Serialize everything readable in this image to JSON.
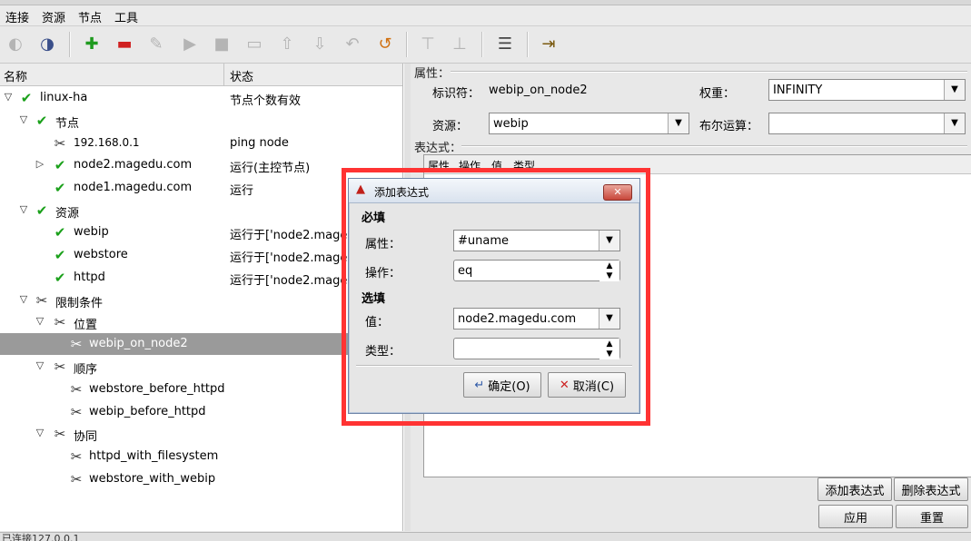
{
  "menubar": {
    "items": [
      "连接",
      "资源",
      "节点",
      "工具"
    ]
  },
  "toolbar": {
    "buttons": [
      {
        "icon": "connect-icon",
        "glyph": "◐"
      },
      {
        "icon": "disconnect-icon",
        "glyph": "◑"
      },
      {
        "icon": "add-icon",
        "glyph": "✚"
      },
      {
        "icon": "remove-icon",
        "glyph": "▬"
      },
      {
        "icon": "cleanup-icon",
        "glyph": "✎"
      },
      {
        "icon": "start-icon",
        "glyph": "▶"
      },
      {
        "icon": "stop-icon",
        "glyph": "■"
      },
      {
        "icon": "default-icon",
        "glyph": "▭"
      },
      {
        "icon": "up-icon",
        "glyph": "⇧"
      },
      {
        "icon": "down-icon",
        "glyph": "⇩"
      },
      {
        "icon": "undo-icon",
        "glyph": "↶"
      },
      {
        "icon": "refresh-icon",
        "glyph": "↺"
      },
      {
        "icon": "standby-icon",
        "glyph": "⊤"
      },
      {
        "icon": "active-icon",
        "glyph": "⊥"
      },
      {
        "icon": "log-icon",
        "glyph": "☰"
      },
      {
        "icon": "exit-icon",
        "glyph": "⇥"
      }
    ]
  },
  "tree": {
    "col_name": "名称",
    "col_status": "状态",
    "rows": [
      {
        "label": "linux-ha",
        "status": "节点个数有效",
        "icon": "check-icon",
        "glyph": "✔",
        "expander": "▽"
      },
      {
        "label": "节点",
        "status": "",
        "icon": "check-icon",
        "glyph": "✔",
        "expander": "▽"
      },
      {
        "label": "192.168.0.1",
        "status": "ping node",
        "icon": "tool-icon",
        "glyph": "✂",
        "expander": ""
      },
      {
        "label": "node2.magedu.com",
        "status": "运行(主控节点)",
        "icon": "check-icon",
        "glyph": "✔",
        "expander": "▷"
      },
      {
        "label": "node1.magedu.com",
        "status": "运行",
        "icon": "check-icon",
        "glyph": "✔",
        "expander": ""
      },
      {
        "label": "资源",
        "status": "",
        "icon": "check-icon",
        "glyph": "✔",
        "expander": "▽"
      },
      {
        "label": "webip",
        "status": "运行于['node2.mage",
        "icon": "check-icon",
        "glyph": "✔",
        "expander": ""
      },
      {
        "label": "webstore",
        "status": "运行于['node2.mage",
        "icon": "check-icon",
        "glyph": "✔",
        "expander": ""
      },
      {
        "label": "httpd",
        "status": "运行于['node2.mage",
        "icon": "check-icon",
        "glyph": "✔",
        "expander": ""
      },
      {
        "label": "限制条件",
        "status": "",
        "icon": "tool-icon",
        "glyph": "✂",
        "expander": "▽"
      },
      {
        "label": "位置",
        "status": "",
        "icon": "tool-icon",
        "glyph": "✂",
        "expander": "▽"
      },
      {
        "label": "webip_on_node2",
        "status": "",
        "icon": "tool-icon",
        "glyph": "✂",
        "expander": ""
      },
      {
        "label": "顺序",
        "status": "",
        "icon": "tool-icon",
        "glyph": "✂",
        "expander": "▽"
      },
      {
        "label": "webstore_before_httpd",
        "status": "",
        "icon": "tool-icon",
        "glyph": "✂",
        "expander": ""
      },
      {
        "label": "webip_before_httpd",
        "status": "",
        "icon": "tool-icon",
        "glyph": "✂",
        "expander": ""
      },
      {
        "label": "协同",
        "status": "",
        "icon": "tool-icon",
        "glyph": "✂",
        "expander": "▽"
      },
      {
        "label": "httpd_with_filesystem",
        "status": "",
        "icon": "tool-icon",
        "glyph": "✂",
        "expander": ""
      },
      {
        "label": "webstore_with_webip",
        "status": "",
        "icon": "tool-icon",
        "glyph": "✂",
        "expander": ""
      }
    ]
  },
  "properties": {
    "group_label": "属性：",
    "id_label": "标识符：",
    "id_value": "webip_on_node2",
    "weight_label": "权重：",
    "weight_value": "INFINITY",
    "resource_label": "资源：",
    "resource_value": "webip",
    "bool_label": "布尔运算：",
    "bool_value": "",
    "expr_group_label": "表达式：",
    "expr_columns": [
      "属性",
      "操作",
      "值",
      "类型"
    ],
    "add_expr_button": "添加表达式",
    "del_expr_button": "删除表达式",
    "apply_button": "应用",
    "reset_button": "重置"
  },
  "dialog": {
    "title": "添加表达式",
    "required_section": "必填",
    "attribute_label": "属性：",
    "attribute_value": "#uname",
    "operation_label": "操作：",
    "operation_value": "eq",
    "optional_section": "选填",
    "value_label": "值：",
    "value_value": "node2.magedu.com",
    "type_label": "类型：",
    "type_value": "",
    "ok_button": "确定(O)",
    "cancel_button": "取消(C)",
    "close_glyph": "✕"
  },
  "statusbar": {
    "text": "已连接127.0.0.1"
  }
}
